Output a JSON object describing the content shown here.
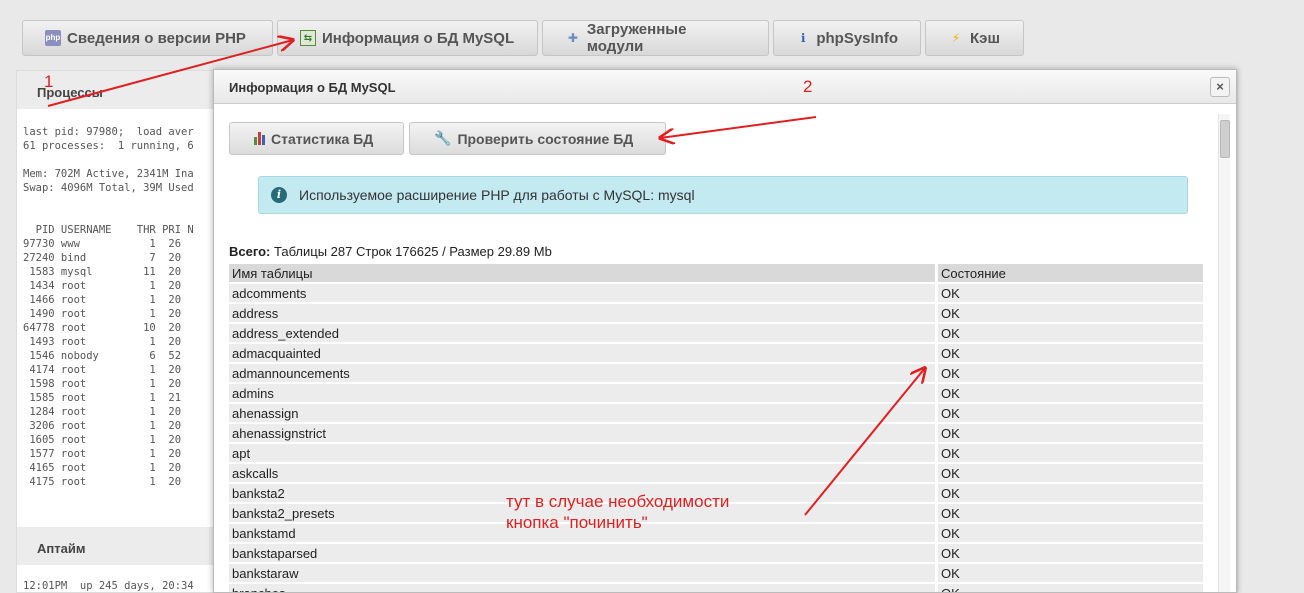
{
  "tabs": [
    {
      "label": "Сведения о версии PHP",
      "icon": "php-icon"
    },
    {
      "label": "Информация о БД MySQL",
      "icon": "database-icon"
    },
    {
      "label": "Загруженные модули",
      "icon": "puzzle-icon"
    },
    {
      "label": "phpSysInfo",
      "icon": "info-icon"
    },
    {
      "label": "Кэш",
      "icon": "bolt-icon"
    }
  ],
  "background": {
    "processes_title": "Процессы",
    "top_output": "last pid: 97980;  load aver\n61 processes:  1 running, 6\n\nMem: 702M Active, 2341M Ina\nSwap: 4096M Total, 39M Used\n\n\n  PID USERNAME    THR PRI N\n97730 www           1  26\n27240 bind          7  20\n 1583 mysql        11  20\n 1434 root          1  20\n 1466 root          1  20\n 1490 root          1  20\n64778 root         10  20\n 1493 root          1  20\n 1546 nobody        6  52\n 4174 root          1  20\n 1598 root          1  20\n 1585 root          1  21\n 1284 root          1  20\n 3206 root          1  20\n 1605 root          1  20\n 1577 root          1  20\n 4165 root          1  20\n 4175 root          1  20",
    "uptime_title": "Аптайм",
    "uptime_output": "12:01PM  up 245 days, 20:34"
  },
  "modal": {
    "title": "Информация о БД MySQL",
    "close_label": "×",
    "btn_stats": "Статистика БД",
    "btn_check": "Проверить состояние БД",
    "alert_text": "Используемое расширение PHP для работы с MySQL: mysql",
    "summary_label": "Всего:",
    "summary_text": " Таблицы 287 Строк 176625 / Размер 29.89 Mb",
    "table": {
      "col_name": "Имя таблицы",
      "col_status": "Состояние",
      "rows": [
        [
          "adcomments",
          "OK"
        ],
        [
          "address",
          "OK"
        ],
        [
          "address_extended",
          "OK"
        ],
        [
          "admacquainted",
          "OK"
        ],
        [
          "admannouncements",
          "OK"
        ],
        [
          "admins",
          "OK"
        ],
        [
          "ahenassign",
          "OK"
        ],
        [
          "ahenassignstrict",
          "OK"
        ],
        [
          "apt",
          "OK"
        ],
        [
          "askcalls",
          "OK"
        ],
        [
          "banksta2",
          "OK"
        ],
        [
          "banksta2_presets",
          "OK"
        ],
        [
          "bankstamd",
          "OK"
        ],
        [
          "bankstaparsed",
          "OK"
        ],
        [
          "bankstaraw",
          "OK"
        ],
        [
          "branches",
          "OK"
        ]
      ]
    }
  },
  "annotations": {
    "n1": "1",
    "n2": "2",
    "note_line1": "тут в случае необходимости",
    "note_line2": "кнопка \"починить\"",
    "color": "#e02020"
  }
}
